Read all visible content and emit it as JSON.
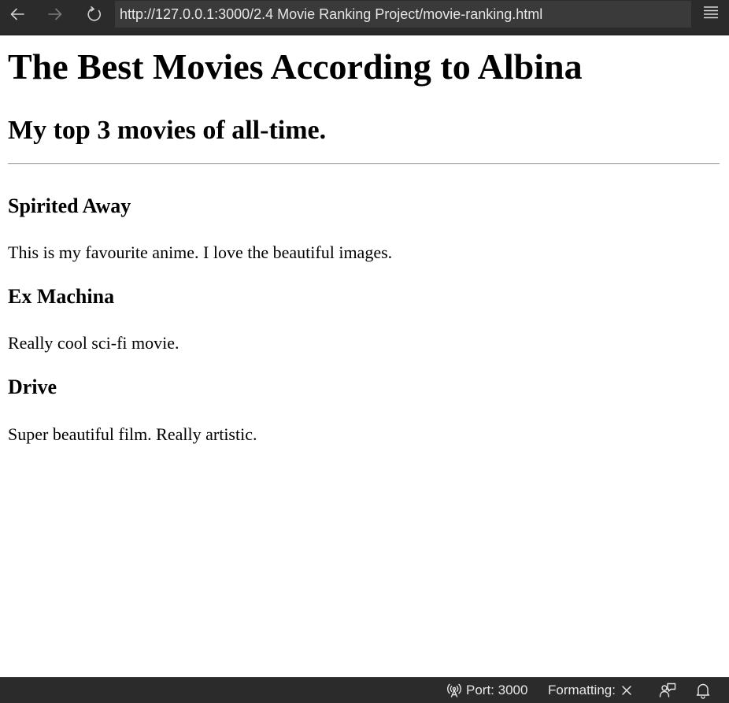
{
  "browser": {
    "url": "http://127.0.0.1:3000/2.4 Movie Ranking Project/movie-ranking.html",
    "icons": {
      "back": "arrow-left-icon",
      "forward": "arrow-right-icon",
      "reload": "reload-icon",
      "menu": "hamburger-menu-icon"
    }
  },
  "page": {
    "heading": "The Best Movies According to Albina",
    "subheading": "My top 3 movies of all-time.",
    "movies": [
      {
        "title": "Spirited Away",
        "description": "This is my favourite anime. I love the beautiful images."
      },
      {
        "title": "Ex Machina",
        "description": "Really cool sci-fi movie."
      },
      {
        "title": "Drive",
        "description": "Super beautiful film. Really artistic."
      }
    ]
  },
  "status_bar": {
    "port_label": "Port: 3000",
    "formatting_label": "Formatting:",
    "icons": {
      "port": "broadcast-icon",
      "formatting": "close-icon",
      "feedback": "feedback-icon",
      "notifications": "bell-icon"
    }
  },
  "colors": {
    "chrome_background": "#2b2b2b",
    "url_bar_background": "#3a3a3a",
    "chrome_text": "#e6e6e6",
    "page_background": "#ffffff",
    "page_text": "#000000"
  }
}
